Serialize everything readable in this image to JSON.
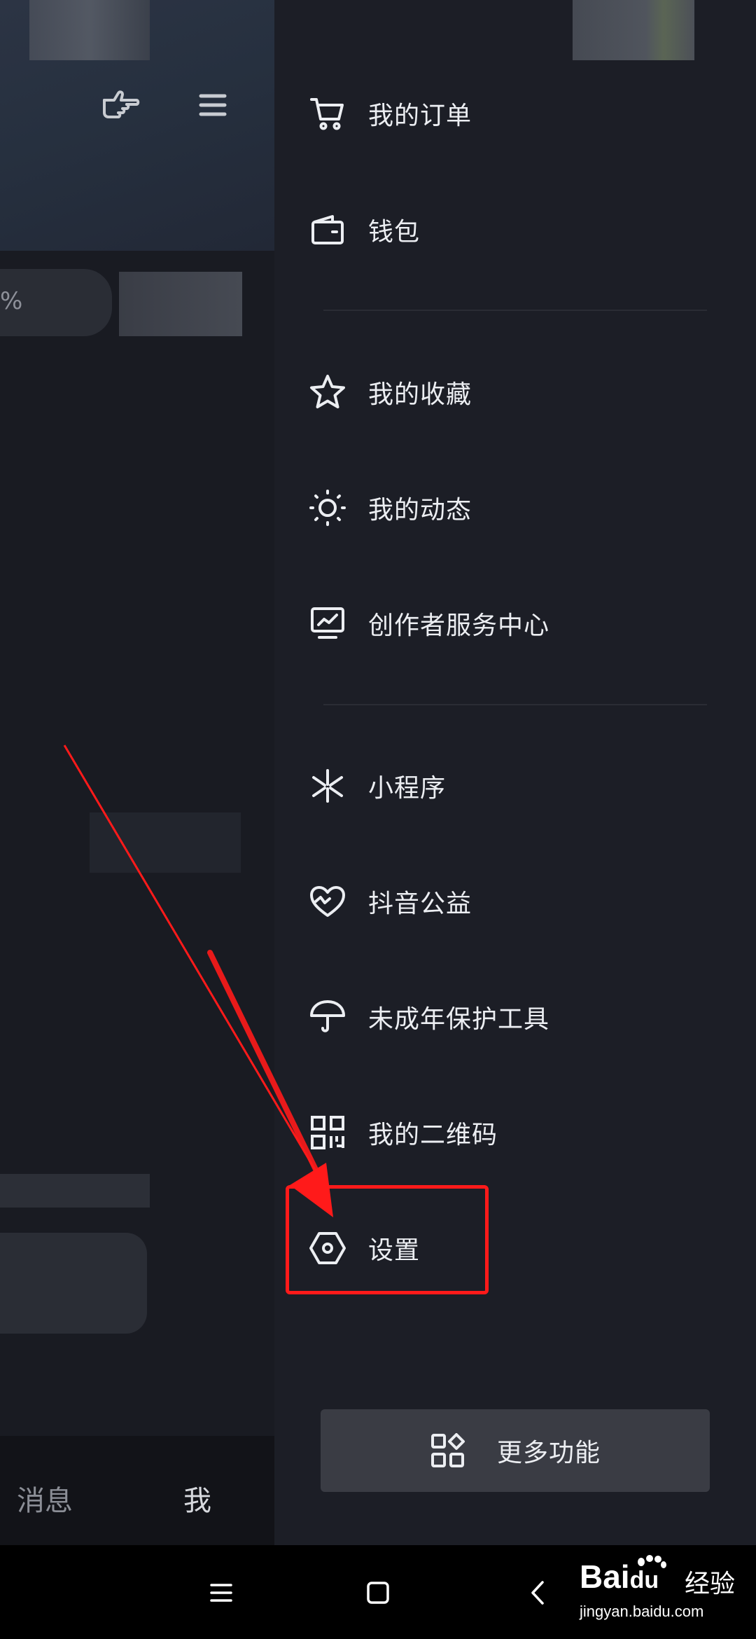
{
  "background_page": {
    "percent_fragment": "%",
    "tabs": [
      {
        "label": "消息"
      },
      {
        "label": "我"
      }
    ],
    "icons": [
      "pointing-hand-icon",
      "hamburger-menu-icon"
    ]
  },
  "drawer": {
    "menu_groups": [
      [
        {
          "label": "我的订单",
          "icon": "shopping-cart-icon"
        },
        {
          "label": "钱包",
          "icon": "wallet-icon"
        }
      ],
      [
        {
          "label": "我的收藏",
          "icon": "star-icon"
        },
        {
          "label": "我的动态",
          "icon": "sun-icon"
        },
        {
          "label": "创作者服务中心",
          "icon": "monitor-chart-icon"
        }
      ],
      [
        {
          "label": "小程序",
          "icon": "mini-program-icon"
        },
        {
          "label": "抖音公益",
          "icon": "heart-charity-icon"
        },
        {
          "label": "未成年保护工具",
          "icon": "umbrella-icon"
        },
        {
          "label": "我的二维码",
          "icon": "qr-code-icon"
        },
        {
          "label": "设置",
          "icon": "hexagon-settings-icon"
        }
      ]
    ],
    "more_button": {
      "label": "更多功能",
      "icon": "apps-grid-icon"
    }
  },
  "annotation": {
    "highlight_color": "#ff1a1a",
    "highlighted_item": "设置"
  },
  "system_nav": {
    "buttons": [
      "recent-apps-icon",
      "home-icon",
      "back-icon"
    ]
  },
  "watermark": {
    "brand": "Bai",
    "brand_suffix": "du",
    "product": "经验",
    "url": "jingyan.baidu.com"
  }
}
